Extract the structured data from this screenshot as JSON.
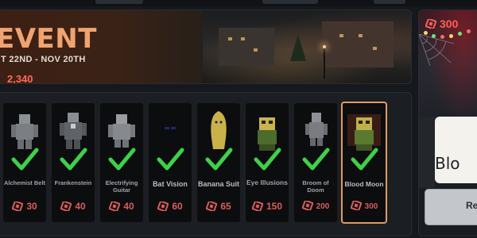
{
  "banner": {
    "title": "EVENT",
    "dates": "T 22ND - NOV 20TH",
    "points": "2,340"
  },
  "items": [
    {
      "name": "Alchemist Belt",
      "price": "30"
    },
    {
      "name": "Frankenstein",
      "price": "40"
    },
    {
      "name": "Electrifying Guitar",
      "price": "40"
    },
    {
      "name": "Bat Vision",
      "price": "60"
    },
    {
      "name": "Banana Suit",
      "price": "65"
    },
    {
      "name": "Eye Illusions",
      "price": "150"
    },
    {
      "name": "Broom of Doom",
      "price": "200"
    },
    {
      "name": "Blood Moon",
      "price": "300"
    }
  ],
  "side": {
    "price": "300",
    "card_label": "Blo",
    "button_label": "Re"
  },
  "colors": {
    "accent": "#f1a36f",
    "price_red": "#d85d58",
    "check_green": "#3fd04a",
    "selected_border": "#e29a63"
  },
  "icons": {
    "check": "check-icon",
    "ticket": "ticket-icon"
  }
}
